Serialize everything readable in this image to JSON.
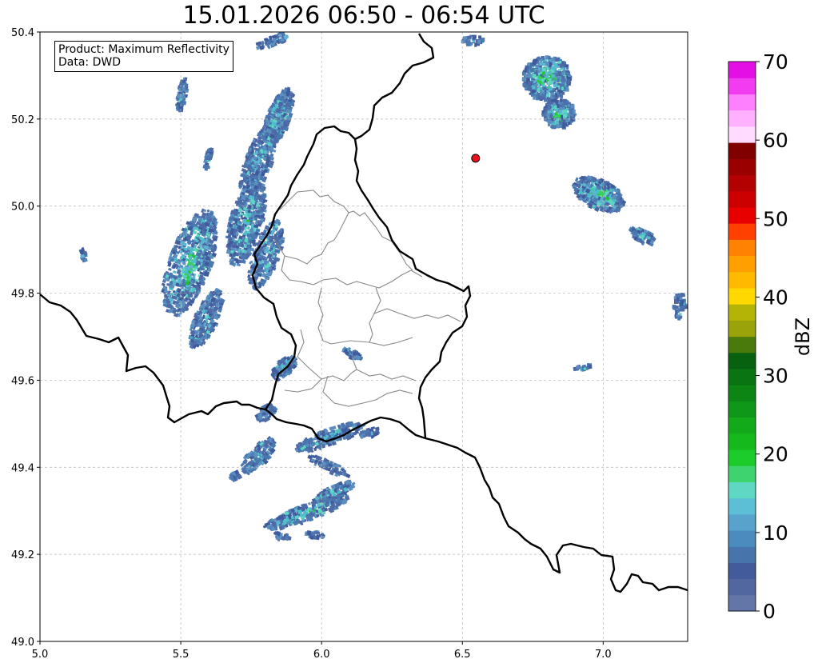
{
  "title": "15.01.2026 06:50 - 06:54 UTC",
  "info": {
    "product_line": "Product: Maximum Reflectivity",
    "data_line": "Data: DWD"
  },
  "map": {
    "lon_range": [
      5.0,
      7.3
    ],
    "lat_range": [
      49.0,
      50.4
    ],
    "x_ticks": [
      "5.0",
      "5.5",
      "6.0",
      "6.5",
      "7.0"
    ],
    "y_ticks": [
      "49.0",
      "49.2",
      "49.4",
      "49.6",
      "49.8",
      "50.0",
      "50.2",
      "50.4"
    ],
    "grid": true,
    "marker": {
      "lon": 6.547,
      "lat": 50.11,
      "color": "#e8141c",
      "shape": "circle-marker"
    }
  },
  "colorbar": {
    "label": "dBZ",
    "range": [
      0,
      70
    ],
    "tick_labels": [
      "0",
      "10",
      "20",
      "30",
      "40",
      "50",
      "60",
      "70"
    ],
    "colors": [
      "#6277a8",
      "#53679f",
      "#435a9b",
      "#4775ab",
      "#4c8bbd",
      "#58a3cc",
      "#5dbfd6",
      "#5ed8c3",
      "#3fd36f",
      "#1ccc2a",
      "#16b91b",
      "#12a91a",
      "#0f9718",
      "#0c8515",
      "#0a7312",
      "#08610f",
      "#4a7a0c",
      "#9aa40a",
      "#b2b406",
      "#ffd800",
      "#ffbb00",
      "#ff9f00",
      "#ff8200",
      "#ff4000",
      "#e80000",
      "#cc0000",
      "#b30000",
      "#990000",
      "#800000",
      "#ffdcff",
      "#ffb0ff",
      "#ff80ff",
      "#f23cf2",
      "#e40fe4"
    ]
  }
}
